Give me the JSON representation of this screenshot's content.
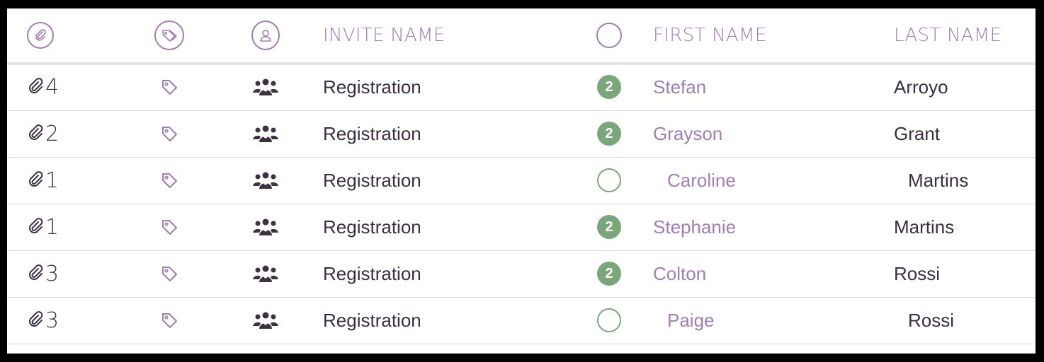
{
  "header": {
    "invite_name": "INVITE NAME",
    "first_name": "FIRST NAME",
    "last_name": "LAST NAME"
  },
  "accent_color": "#a07fb2",
  "status_color": "#7aa77a",
  "rows": [
    {
      "attachments": "4",
      "invite": "Registration",
      "status": "2",
      "status_filled": true,
      "first": "Stefan",
      "last": "Arroyo"
    },
    {
      "attachments": "2",
      "invite": "Registration",
      "status": "2",
      "status_filled": true,
      "first": "Grayson",
      "last": "Grant"
    },
    {
      "attachments": "1",
      "invite": "Registration",
      "status": "",
      "status_filled": false,
      "first": "Caroline",
      "last": "Martins"
    },
    {
      "attachments": "1",
      "invite": "Registration",
      "status": "2",
      "status_filled": true,
      "first": "Stephanie",
      "last": "Martins"
    },
    {
      "attachments": "3",
      "invite": "Registration",
      "status": "2",
      "status_filled": true,
      "first": "Colton",
      "last": "Rossi"
    },
    {
      "attachments": "3",
      "invite": "Registration",
      "status": "",
      "status_filled": false,
      "first": "Paige",
      "last": "Rossi"
    }
  ]
}
